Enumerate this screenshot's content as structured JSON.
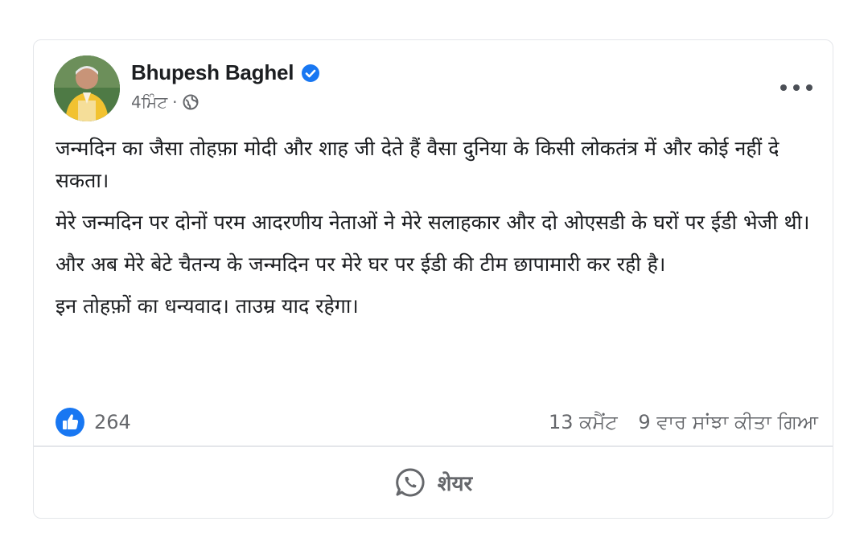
{
  "post": {
    "author": "Bhupesh Baghel",
    "time": "4ਮਿੰਟ",
    "separator": "·",
    "paragraphs": [
      "जन्मदिन का जैसा तोहफ़ा मोदी और शाह जी देते हैं वैसा दुनिया के किसी लोकतंत्र में और कोई नहीं दे सकता।",
      "मेरे जन्मदिन पर दोनों परम आदरणीय नेताओं ने मेरे सलाहकार और दो ओएसडी के घरों पर ईडी भेजी थी।",
      "और अब मेरे बेटे चैतन्य के जन्मदिन पर मेरे घर पर ईडी की टीम छापामारी कर रही है।",
      "इन तोहफ़ों का धन्यवाद। ताउम्र याद रहेगा।"
    ],
    "reactions_count": "264",
    "comments": "13 ਕਮੈਂਟ",
    "shares": "9 ਵਾਰ ਸਾਂਝਾ ਕੀਤਾ ਗਿਆ",
    "share_label": "शेयर"
  },
  "icons": {
    "verified": "verified-badge-icon",
    "globe": "globe-icon",
    "more": "more-options-icon",
    "like": "like-icon",
    "whatsapp": "whatsapp-icon"
  },
  "colors": {
    "accent_blue": "#1877f2",
    "text_primary": "#1c1e21",
    "text_secondary": "#65676b"
  }
}
